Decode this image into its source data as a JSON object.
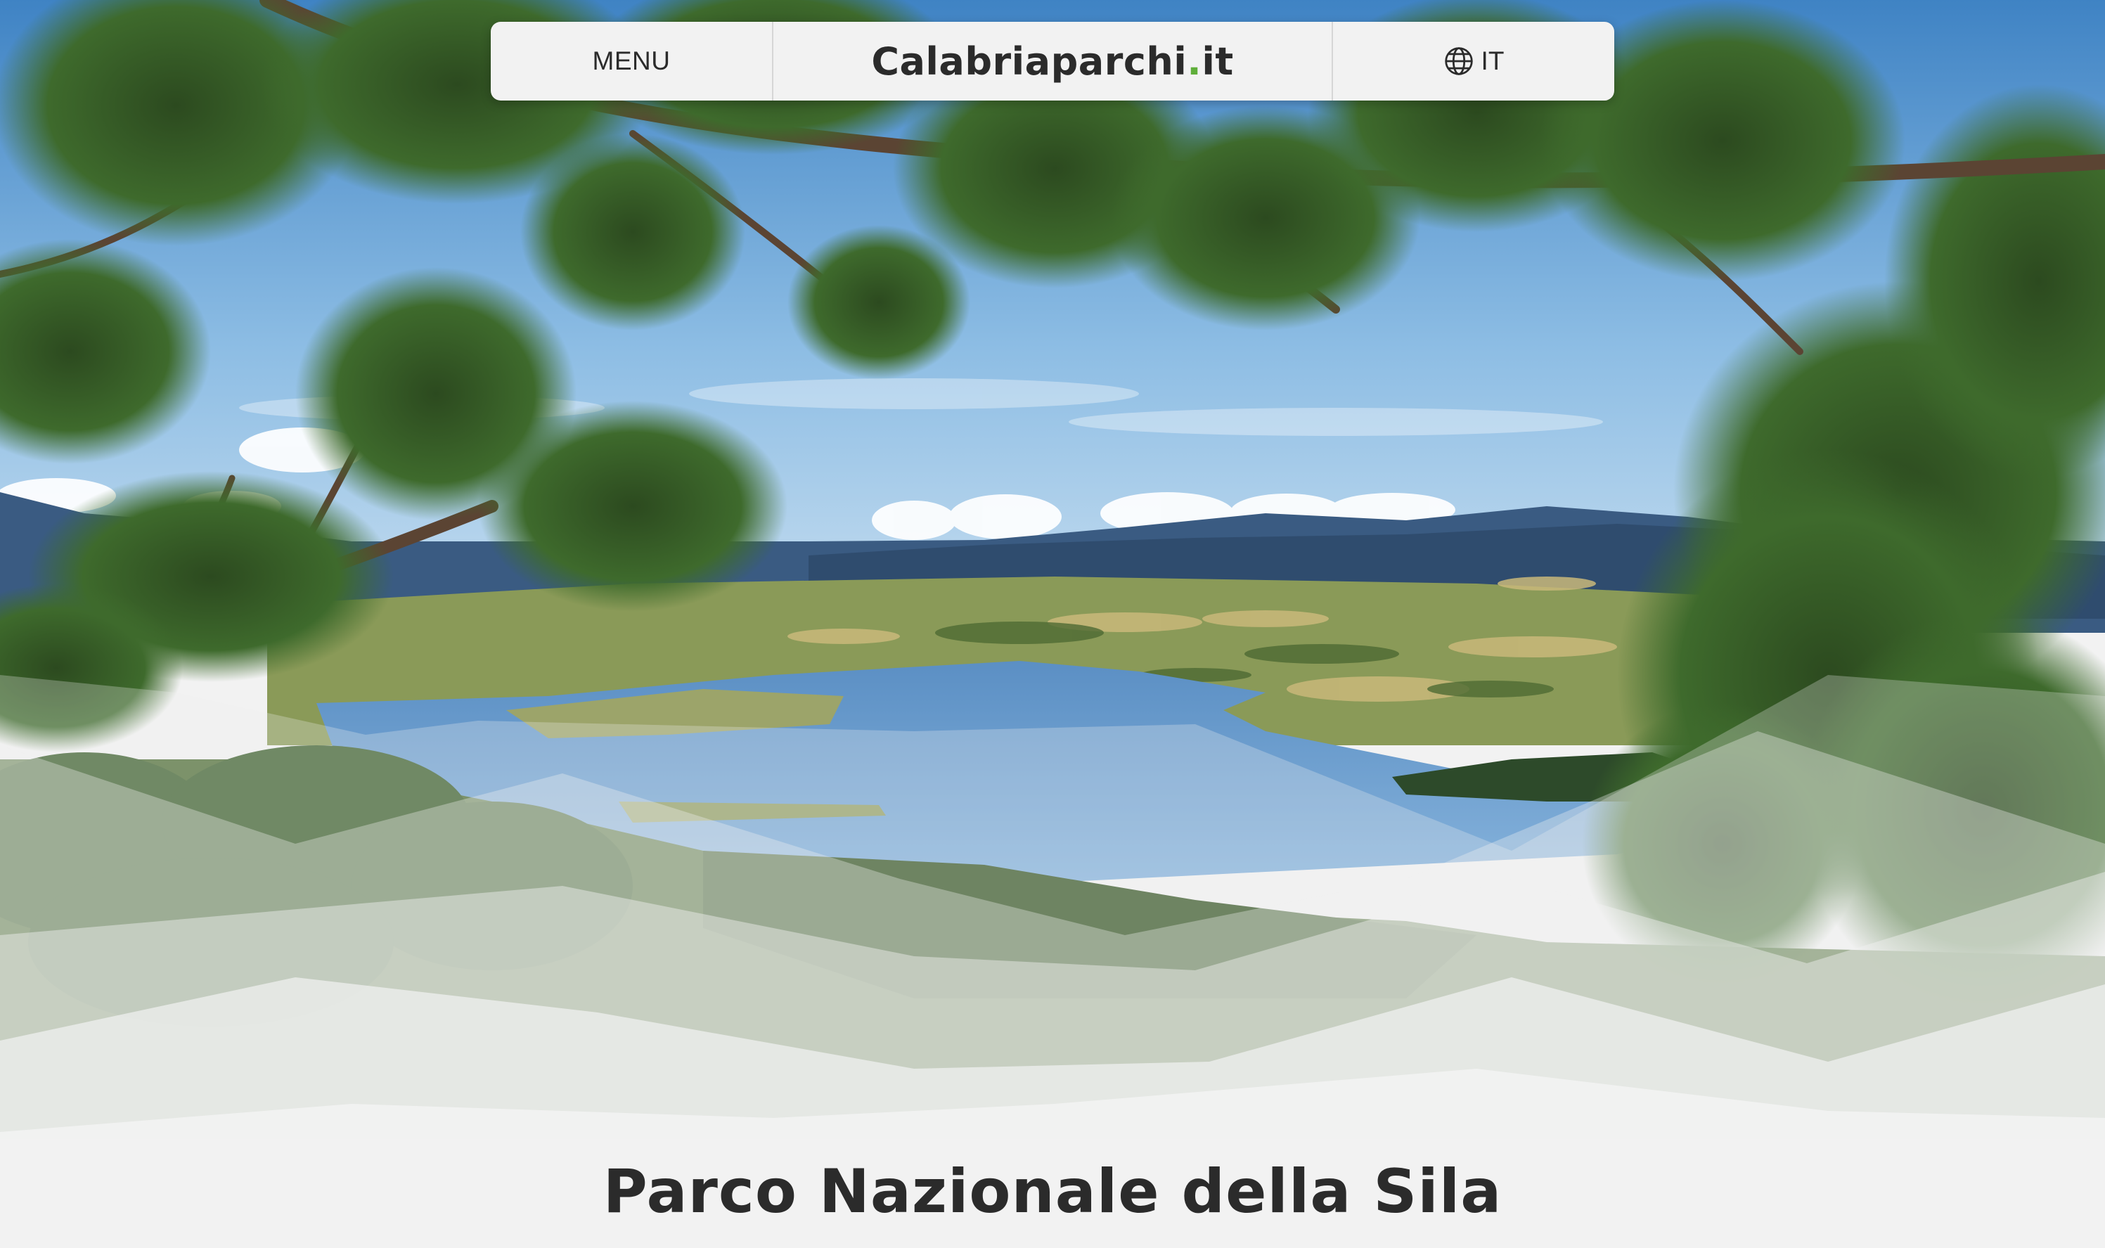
{
  "header": {
    "menu_label": "MENU",
    "logo_main": "Calabriaparchi",
    "logo_dot": ".",
    "logo_tld": "it",
    "language_label": "IT",
    "language_icon": "globe-icon"
  },
  "hero": {
    "image_subject": "lake-landscape-framed-by-pine-branches"
  },
  "main": {
    "title": "Parco Nazionale della Sila"
  },
  "colors": {
    "brand_dot": "#5fae3a",
    "text": "#2b2b2b",
    "nav_background": "#f2f2f2"
  }
}
